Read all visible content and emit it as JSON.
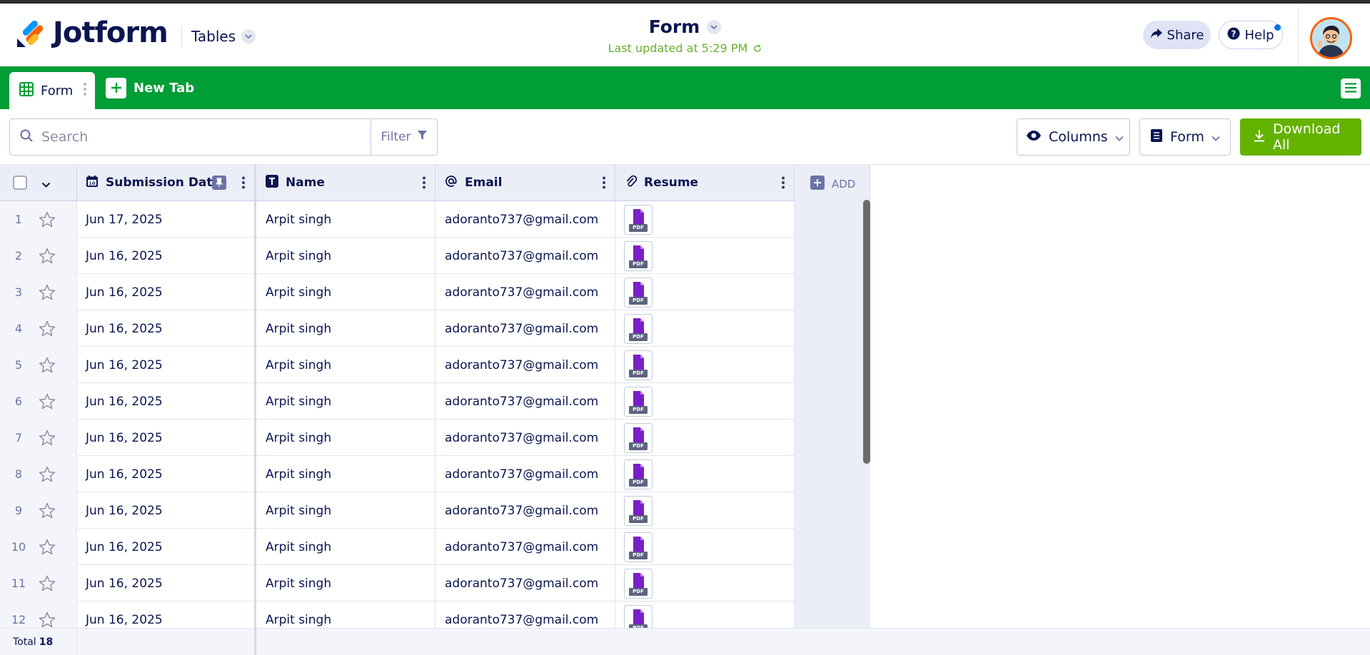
{
  "header": {
    "logo_text": "Jotform",
    "tables_label": "Tables",
    "form_title": "Form",
    "last_updated": "Last updated at 5:29 PM",
    "share_label": "Share",
    "help_label": "Help"
  },
  "tabs": {
    "active_label": "Form",
    "new_tab_label": "New Tab"
  },
  "toolbar": {
    "search_placeholder": "Search",
    "filter_label": "Filter",
    "columns_label": "Columns",
    "form_select_label": "Form",
    "download_label": "Download All"
  },
  "columns": [
    {
      "label": "Submission Date",
      "icon": "calendar-icon"
    },
    {
      "label": "Name",
      "icon": "text-icon"
    },
    {
      "label": "Email",
      "icon": "at-icon"
    },
    {
      "label": "Resume",
      "icon": "paperclip-icon"
    }
  ],
  "add_column_label": "ADD",
  "rows": [
    {
      "num": "1",
      "date": "Jun 17, 2025",
      "name": "Arpit singh",
      "email": "adoranto737@gmail.com",
      "file": "PDF"
    },
    {
      "num": "2",
      "date": "Jun 16, 2025",
      "name": "Arpit singh",
      "email": "adoranto737@gmail.com",
      "file": "PDF"
    },
    {
      "num": "3",
      "date": "Jun 16, 2025",
      "name": "Arpit singh",
      "email": "adoranto737@gmail.com",
      "file": "PDF"
    },
    {
      "num": "4",
      "date": "Jun 16, 2025",
      "name": "Arpit singh",
      "email": "adoranto737@gmail.com",
      "file": "PDF"
    },
    {
      "num": "5",
      "date": "Jun 16, 2025",
      "name": "Arpit singh",
      "email": "adoranto737@gmail.com",
      "file": "PDF"
    },
    {
      "num": "6",
      "date": "Jun 16, 2025",
      "name": "Arpit singh",
      "email": "adoranto737@gmail.com",
      "file": "PDF"
    },
    {
      "num": "7",
      "date": "Jun 16, 2025",
      "name": "Arpit singh",
      "email": "adoranto737@gmail.com",
      "file": "PDF"
    },
    {
      "num": "8",
      "date": "Jun 16, 2025",
      "name": "Arpit singh",
      "email": "adoranto737@gmail.com",
      "file": "PDF"
    },
    {
      "num": "9",
      "date": "Jun 16, 2025",
      "name": "Arpit singh",
      "email": "adoranto737@gmail.com",
      "file": "PDF"
    },
    {
      "num": "10",
      "date": "Jun 16, 2025",
      "name": "Arpit singh",
      "email": "adoranto737@gmail.com",
      "file": "PDF"
    },
    {
      "num": "11",
      "date": "Jun 16, 2025",
      "name": "Arpit singh",
      "email": "adoranto737@gmail.com",
      "file": "PDF"
    },
    {
      "num": "12",
      "date": "Jun 16, 2025",
      "name": "Arpit singh",
      "email": "adoranto737@gmail.com",
      "file": "PDF"
    }
  ],
  "footer": {
    "total_label": "Total",
    "total_value": "18"
  },
  "colors": {
    "brand_green": "#019e36",
    "download_green": "#64b200",
    "navy": "#0a1551",
    "pdf_purple": "#7a1ec6"
  }
}
